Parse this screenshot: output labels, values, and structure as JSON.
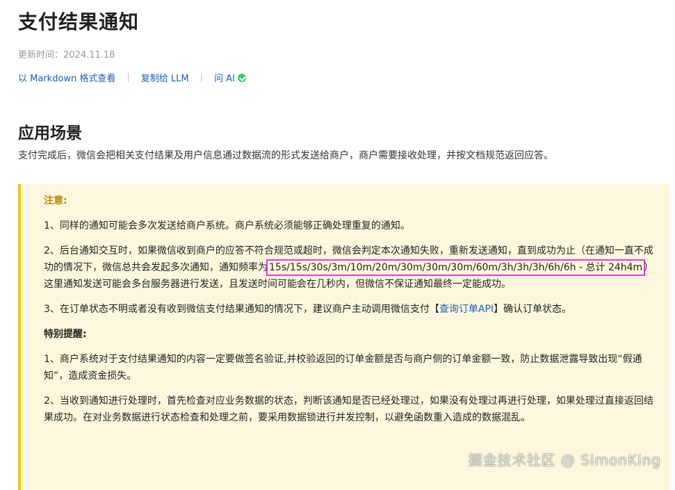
{
  "page": {
    "title": "支付结果通知",
    "updated": "更新时间：2024.11.18"
  },
  "actions": {
    "markdown": "以 Markdown 格式查看",
    "copy_llm": "复制给 LLM",
    "ask_ai": "问 AI",
    "separator": "|"
  },
  "section": {
    "title": "应用场景",
    "desc": "支付完成后，微信会把相关支付结果及用户信息通过数据流的形式发送给商户，商户需要接收处理，并按文档规范返回应答。"
  },
  "notice": {
    "heading": "注意:",
    "p1": "1、同样的通知可能会多次发送给商户系统。商户系统必须能够正确处理重复的通知。",
    "p2_a": "2、后台通知交互时，如果微信收到商户的应答不符合规范或超时，微信会判定本次通知失败，重新发送通知，直到成功为止（在通知一直不成功的情况下，微信总共会发起多次通知，通知频率为",
    "p2_freq": "15s/15s/30s/3m/10m/20m/30m/30m/30m/60m/3h/3h/3h/6h/6h - 总计 24h4m",
    "p2_b": "）这里通知发送可能会多台服务器进行发送，且发送时间可能会在几秒内，但微信不保证通知最终一定能成功。",
    "p3_a": "3、在订单状态不明或者没有收到微信支付结果通知的情况下，建议商户主动调用微信支付【",
    "p3_link": "查询订单API",
    "p3_b": "】确认订单状态。",
    "special_heading": "特别提醒:",
    "s1": "1、商户系统对于支付结果通知的内容一定要做签名验证,并校验返回的订单金额是否与商户侧的订单金额一致，防止数据泄露导致出现“假通知”，造成资金损失。",
    "s2": "2、当收到通知进行处理时，首先检查对应业务数据的状态，判断该通知是否已经处理过，如果没有处理过再进行处理，如果处理过直接返回结果成功。在对业务数据进行状态检查和处理之前，要采用数据锁进行并发控制，以避免函数重入造成的数据混乱。"
  },
  "watermark": "掘金技术社区 @ SimonKing",
  "colors": {
    "link": "#1a5fb4",
    "notice_bg": "#fdf8dd",
    "notice_border": "#f2c518",
    "highlight_border": "#e839e3",
    "ai_icon": "#3cc66c"
  }
}
